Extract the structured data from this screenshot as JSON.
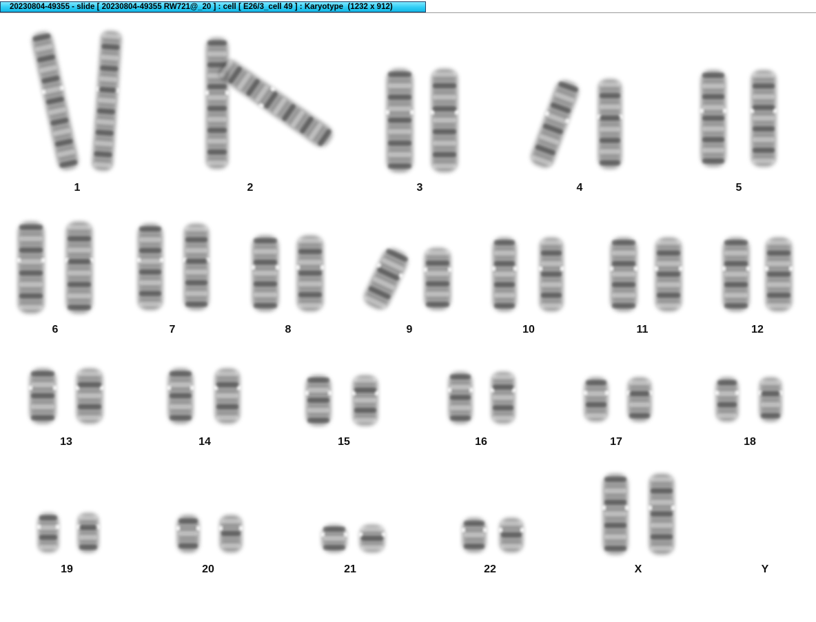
{
  "window": {
    "title": "20230804-49355 - slide [ 20230804-49355 RW721@_20 ] : cell [ E26/3_cell 49 ] : Karyotype  (1232 x 912)",
    "title_colors": {
      "tab_top": "#7fe8ff",
      "tab_bottom": "#14b8e6",
      "border": "#1c3f66"
    }
  },
  "karyotype": {
    "chromosome_color": "#4a4a4a",
    "rows": [
      {
        "labels": [
          "1",
          "2",
          "3",
          "4",
          "5"
        ]
      },
      {
        "labels": [
          "6",
          "7",
          "8",
          "9",
          "10",
          "11",
          "12"
        ]
      },
      {
        "labels": [
          "13",
          "14",
          "15",
          "16",
          "17",
          "18"
        ]
      },
      {
        "labels": [
          "19",
          "20",
          "21",
          "22",
          "X",
          "Y"
        ]
      }
    ]
  }
}
